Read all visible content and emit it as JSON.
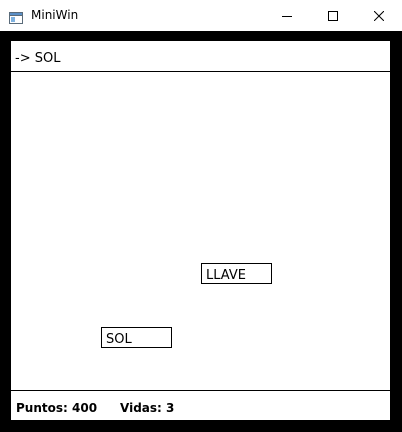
{
  "window": {
    "title": "MiniWin",
    "app_icon": "window-app-icon",
    "controls": {
      "minimize_icon": "minimize-icon",
      "maximize_icon": "maximize-icon",
      "close_icon": "close-icon"
    }
  },
  "hud": {
    "target": "-> SOL",
    "score_label": "Puntos:",
    "score_value": "400",
    "lives_label": "Vidas:",
    "lives_value": "3"
  },
  "items": {
    "llave": "LLAVE",
    "sol": "SOL"
  },
  "colors": {
    "border": "#000000",
    "background": "#ffffff",
    "titlebar": "#ffffff"
  }
}
